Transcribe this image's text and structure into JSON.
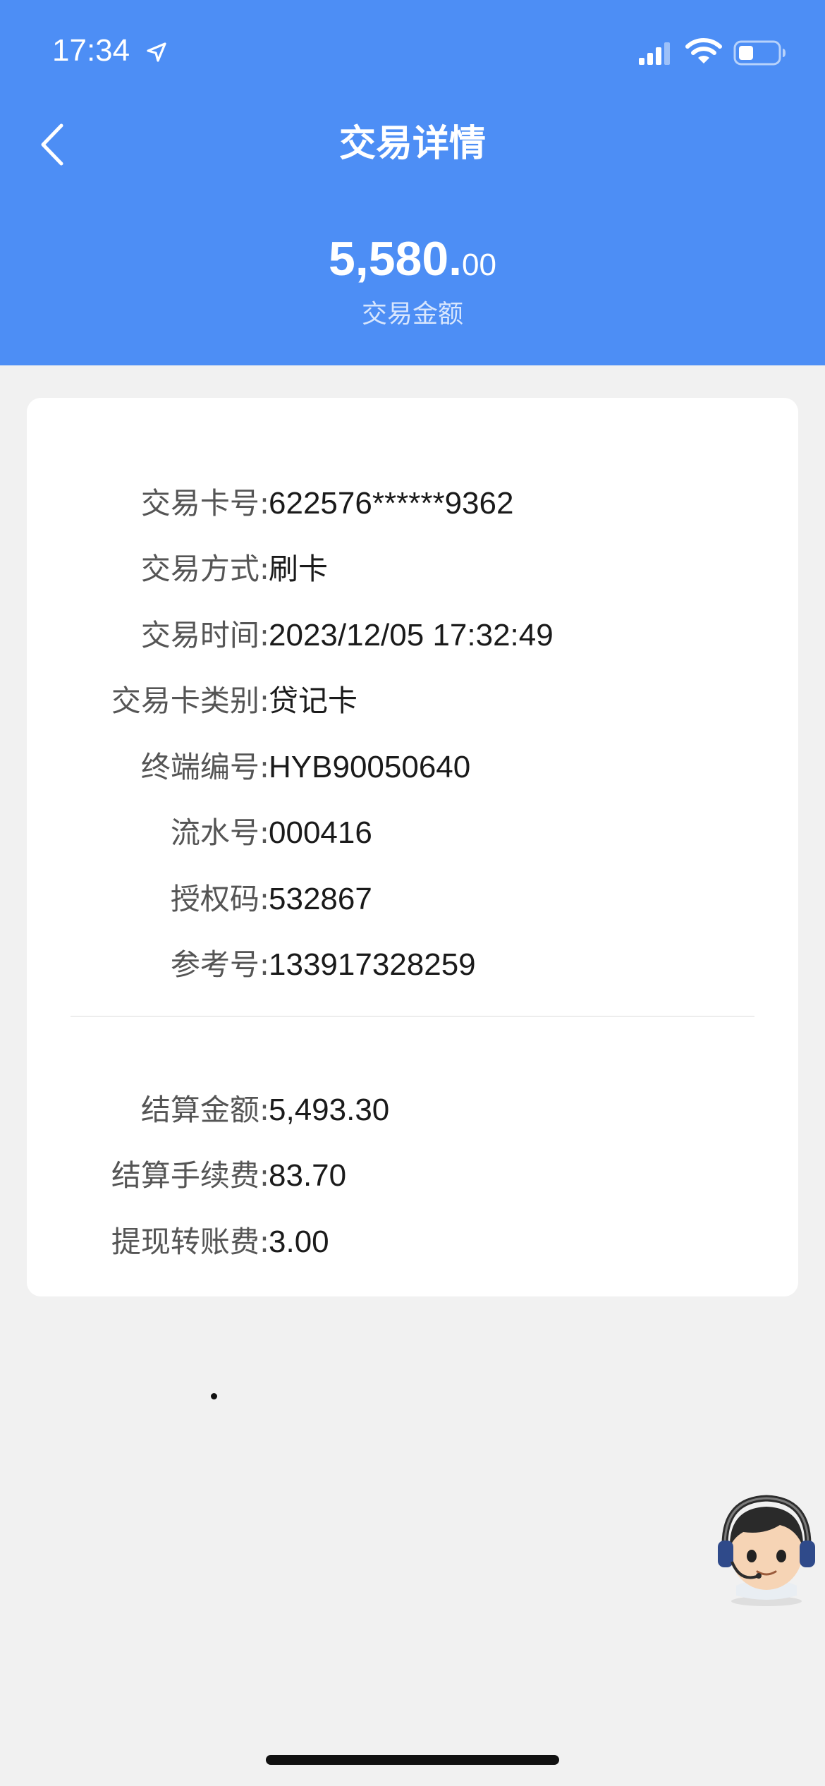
{
  "status_bar": {
    "time": "17:34"
  },
  "nav": {
    "title": "交易详情"
  },
  "summary": {
    "amount_integer": "5,580.",
    "amount_decimal": "00",
    "amount_label": "交易金额"
  },
  "details": [
    {
      "label": "交易卡号:",
      "value": "622576******9362"
    },
    {
      "label": "交易方式:",
      "value": "刷卡"
    },
    {
      "label": "交易时间:",
      "value": "2023/12/05 17:32:49"
    },
    {
      "label": "交易卡类别:",
      "value": "贷记卡"
    },
    {
      "label": "终端编号:",
      "value": "HYB90050640"
    },
    {
      "label": "流水号:",
      "value": "000416"
    },
    {
      "label": "授权码:",
      "value": "532867"
    },
    {
      "label": "参考号:",
      "value": "133917328259"
    }
  ],
  "settlement": [
    {
      "label": "结算金额:",
      "value": "5,493.30"
    },
    {
      "label": "结算手续费:",
      "value": "83.70"
    },
    {
      "label": "提现转账费:",
      "value": "3.00"
    }
  ],
  "colors": {
    "header_blue": "#4d8ef5",
    "page_background": "#f1f1f1",
    "card_background": "#ffffff"
  },
  "icons": {
    "back": "chevron-left-icon",
    "location": "location-arrow-icon",
    "signal": "cellular-signal-icon",
    "wifi": "wifi-icon",
    "battery": "battery-icon",
    "service": "customer-service-avatar-icon"
  }
}
